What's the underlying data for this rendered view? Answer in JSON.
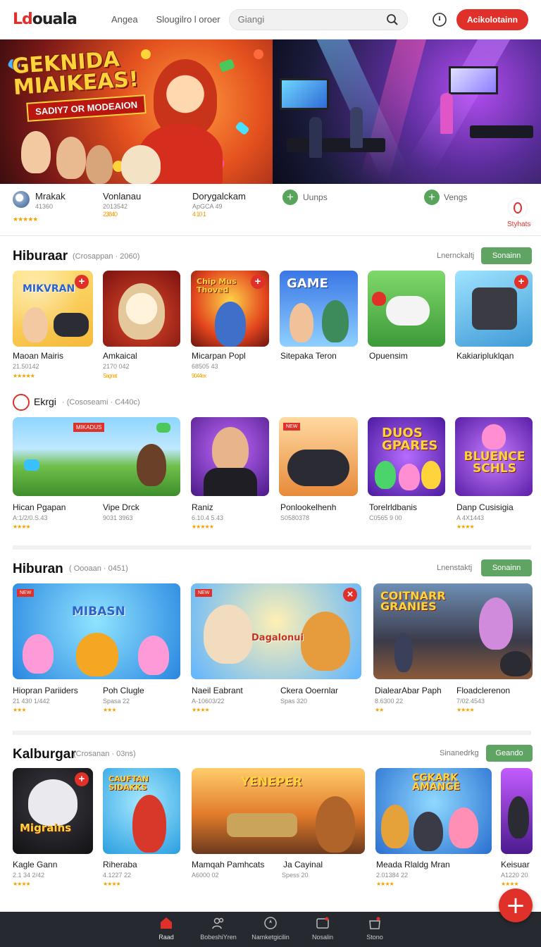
{
  "app": {
    "logo_a": "Ld",
    "logo_b": "ouala"
  },
  "header": {
    "nav": [
      "Angea",
      "Slougilro l oroer"
    ],
    "search_placeholder": "Giangi",
    "cta": "Acikolotainn"
  },
  "hero": {
    "title_1": "GEKNIDA",
    "title_2": "MIAIKEAS!",
    "subtitle": "SADIY7 OR MODEAION"
  },
  "featured": [
    {
      "name": "Mrakak",
      "meta": "41360",
      "stars": "★★★★★"
    },
    {
      "name": "Vonlanau",
      "meta": "2013542",
      "stars": "23840"
    },
    {
      "name": "Dorygalckam",
      "meta": "ApGCA 49",
      "stars": "4 10 1"
    },
    {
      "name": "Uunps"
    },
    {
      "name": "Vengs"
    },
    {
      "name": "Styhats"
    }
  ],
  "sections": [
    {
      "title": "Hiburaar",
      "meta": "(Crosappan · 2060)",
      "link": "Lnernckaltj",
      "button": "Sonainn",
      "tiles": [
        {
          "name": "Maoan Mairis",
          "meta": "21.50142",
          "stars": "★★★★★",
          "art": "MIKVRAN"
        },
        {
          "name": "Amkaical",
          "meta": "2170 042",
          "stars": "Sagnat",
          "art": ""
        },
        {
          "name": "Micarpan Popl",
          "meta": "68505 43",
          "stars": "9044ex",
          "art": "Chip Mus Thoved"
        },
        {
          "name": "Sitepaka Teron",
          "meta": "",
          "stars": "",
          "art": "GAME"
        },
        {
          "name": "Opuensim",
          "meta": "",
          "stars": "",
          "art": ""
        },
        {
          "name": "Kakiaripluklqan",
          "meta": "",
          "stars": "",
          "art": ""
        }
      ]
    },
    {
      "title": "Ekrgi",
      "meta": "· (Cososeami · C440c)",
      "tiles": [
        {
          "name": "Hican Pgapan",
          "meta": "A:1/2/0.S.43",
          "stars": "★★★★",
          "art": ""
        },
        {
          "name": "Vipe Drck",
          "meta": "9031 3963",
          "stars": "",
          "art": ""
        },
        {
          "name": "Raniz",
          "meta": "6.10.4 5.43",
          "stars": "★★★★★",
          "art": ""
        },
        {
          "name": "Ponlookelhenh",
          "meta": "S0580378",
          "stars": "",
          "art": ""
        },
        {
          "name": "Torelrldbanis",
          "meta": "C0565 9 00",
          "stars": "",
          "art": "DUOS GPARES"
        },
        {
          "name": "Danp Cusisigia",
          "meta": "A 4X1443",
          "stars": "★★★★",
          "art": "BLUENCE SCHLS"
        }
      ]
    },
    {
      "title": "Hiburan",
      "meta": "( Oooaan · 0451)",
      "link": "Lnenstaktj",
      "button": "Sonainn",
      "tiles": [
        {
          "name": "Hiopran Pariiders",
          "meta": "21 430 1/442",
          "stars": "★★★",
          "art": "MIBASN"
        },
        {
          "name": "Poh Clugle",
          "meta": "Spasa 22",
          "stars": "★★★",
          "art": ""
        },
        {
          "name": "Naeil Eabrant",
          "meta": "A-10603/22",
          "stars": "★★★★",
          "art": "Dagalonui"
        },
        {
          "name": "Ckera Ooernlar",
          "meta": "Spas 320",
          "stars": "",
          "art": ""
        },
        {
          "name": "DialearAbar Paph",
          "meta": "8.6300 22",
          "stars": "★★",
          "art": "COITNARR GRANIES"
        },
        {
          "name": "Floadclerenon",
          "meta": "7/02.4543",
          "stars": "★★★★",
          "art": ""
        }
      ]
    },
    {
      "title": "Kalburgar",
      "meta": "(Crosanan · 03ns)",
      "link": "Sinanedrkg",
      "button": "Geando",
      "tiles": [
        {
          "name": "Kagle Gann",
          "meta": "2.1 34 2/42",
          "stars": "★★★★",
          "art": "Migrains"
        },
        {
          "name": "Riheraba",
          "meta": "4.1227 22",
          "stars": "★★★★",
          "art": "CAUFTAN SIDAKKS"
        },
        {
          "name": "Mamqah Pamhcats",
          "meta": "A6000 02",
          "stars": "",
          "art": "YENEPER"
        },
        {
          "name": "Ja Cayinal",
          "meta": "Spess 20",
          "stars": "",
          "art": ""
        },
        {
          "name": "Meada Rlaldg Mran",
          "meta": "2.01384 22",
          "stars": "★★★★",
          "art": "CGKARK AMANGE"
        },
        {
          "name": "Keisuar",
          "meta": "A1220 20",
          "stars": "★★★★",
          "art": ""
        }
      ]
    }
  ],
  "bottom_nav": [
    "Raad",
    "BobeshiYren",
    "Namketgicilin",
    "Nosalin",
    "Stono"
  ],
  "fab": "+",
  "colors": {
    "accent": "#e0302a",
    "green": "#5fa463",
    "nav_bg": "#262a30"
  }
}
